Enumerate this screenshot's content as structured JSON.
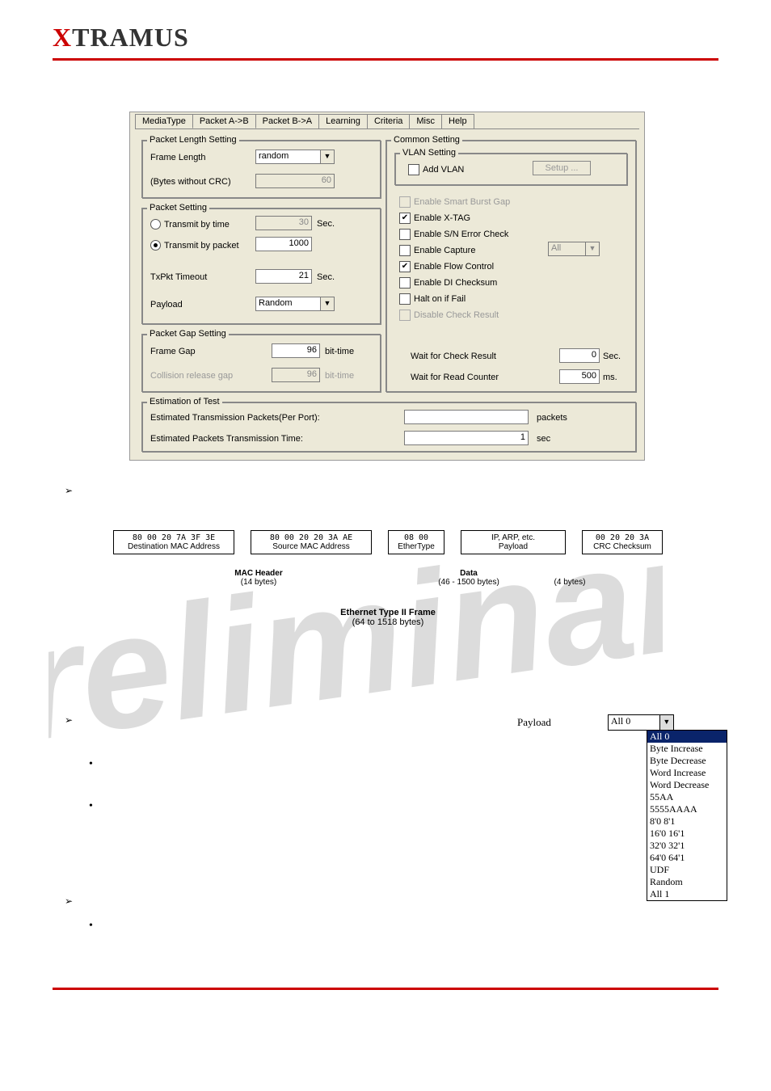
{
  "brand": {
    "x": "X",
    "rest": "TRAMUS"
  },
  "tabs": {
    "media": "MediaType",
    "ab": "Packet A->B",
    "ba": "Packet B->A",
    "learning": "Learning",
    "criteria": "Criteria",
    "misc": "Misc",
    "help": "Help"
  },
  "pls": {
    "legend": "Packet Length Setting",
    "frame_length_label": "Frame Length",
    "frame_length_value": "random",
    "bytes_label": "(Bytes without CRC)",
    "bytes_value": "60"
  },
  "ps": {
    "legend": "Packet Setting",
    "tbt_label": "Transmit by time",
    "tbt_value": "30",
    "tbt_unit": "Sec.",
    "tbp_label": "Transmit by packet",
    "tbp_value": "1000",
    "txpkt_label": "TxPkt Timeout",
    "txpkt_value": "21",
    "txpkt_unit": "Sec.",
    "payload_label": "Payload",
    "payload_value": "Random"
  },
  "pgs": {
    "legend": "Packet Gap Setting",
    "fg_label": "Frame Gap",
    "fg_value": "96",
    "fg_unit": "bit-time",
    "crg_label": "Collision release gap",
    "crg_value": "96",
    "crg_unit": "bit-time"
  },
  "cs": {
    "legend": "Common Setting",
    "vlan_legend": "VLAN Setting",
    "add_vlan": "Add VLAN",
    "setup": "Setup ...",
    "smart_burst": "Enable Smart Burst Gap",
    "xtag": "Enable X-TAG",
    "snerr": "Enable S/N Error Check",
    "capture": "Enable Capture",
    "capture_sel": "All",
    "flow": "Enable Flow Control",
    "dichk": "Enable DI Checksum",
    "halt": "Halt on if Fail",
    "disres": "Disable Check Result",
    "wcr_label": "Wait for Check Result",
    "wcr_value": "0",
    "wcr_unit": "Sec.",
    "wrc_label": "Wait for Read Counter",
    "wrc_value": "500",
    "wrc_unit": "ms."
  },
  "est": {
    "legend": "Estimation of Test",
    "epp_label": "Estimated Transmission Packets(Per Port):",
    "epp_value": "",
    "epp_unit": "packets",
    "ept_label": "Estimated Packets Transmission Time:",
    "ept_value": "1",
    "ept_unit": "sec"
  },
  "frame": {
    "dst_hex": "80  00  20  7A  3F  3E",
    "dst_lab": "Destination MAC Address",
    "src_hex": "80  00  20  20  3A  AE",
    "src_lab": "Source MAC Address",
    "et_hex": "08  00",
    "et_lab": "EtherType",
    "pl_hex": "IP, ARP, etc.",
    "pl_lab": "Payload",
    "crc_hex": "00  20  20  3A",
    "crc_lab": "CRC Checksum",
    "mac_header": "MAC Header",
    "mac_bytes": "(14 bytes)",
    "data_lab": "Data",
    "data_bytes": "(46 - 1500 bytes)",
    "crc_bytes": "(4 bytes)",
    "title": "Ethernet Type II Frame",
    "title_sub": "(64 to 1518 bytes)"
  },
  "payload_dd": {
    "label": "Payload",
    "selected": "All 0",
    "opts": [
      "All 0",
      "Byte Increase",
      "Byte Decrease",
      "Word Increase",
      "Word Decrease",
      "55AA",
      "5555AAAA",
      "8'0 8'1",
      "16'0 16'1",
      "32'0 32'1",
      "64'0 64'1",
      "UDF",
      "Random",
      "All 1"
    ]
  }
}
